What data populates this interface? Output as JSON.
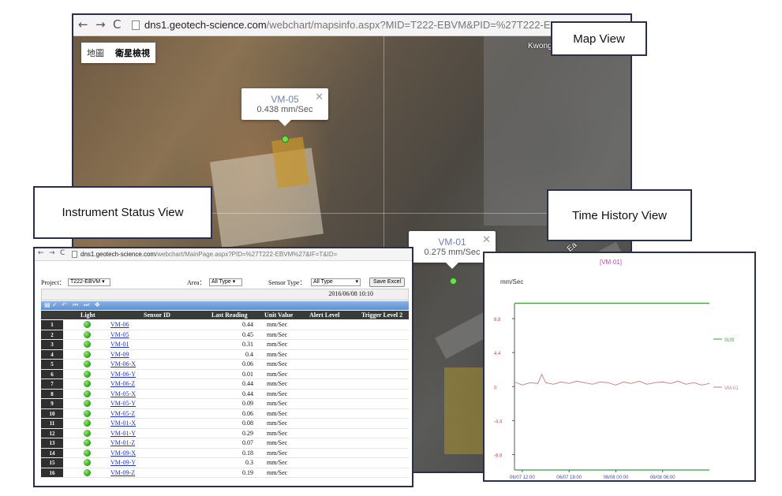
{
  "callouts": {
    "map": "Map View",
    "status": "Instrument Status View",
    "history": "Time History View"
  },
  "map_window": {
    "url_domain": "dns1.geotech-science.com",
    "url_path": "/webchart/mapsinfo.aspx?MID=T222-EBVM&PID=%27T222-EBVM%27",
    "map_type_tabs": [
      "地圖",
      "衛星檢視"
    ],
    "place_label": "Kwong",
    "road_label": "Ea",
    "popups": [
      {
        "name": "VM-05",
        "value": "0.438 mm/Sec"
      },
      {
        "name": "VM-01",
        "value": "0.275 mm/Sec"
      }
    ],
    "close_symbol": "✕"
  },
  "status_window": {
    "url_domain": "dns1.geotech-science.com",
    "url_path": "/webchart/MainPage.aspx?PID=%27T222-EBVM%27&IF=T&ID=",
    "project_label": "Project：",
    "project_value": "T222-EBVM",
    "area_label": "Area：",
    "area_value": "All Type",
    "sensor_type_label": "Sensor Type：",
    "sensor_type_value": "All Type",
    "save_button": "Save Excel",
    "timestamp": "2016/06/08 10:10",
    "columns": [
      "Light",
      "Sensor ID",
      "Last Reading",
      "Unit Value",
      "Alert Level",
      "Trigger Level 2"
    ],
    "rows": [
      {
        "n": "1",
        "id": "VM-06",
        "reading": "0.44",
        "unit": "mm/Sec"
      },
      {
        "n": "2",
        "id": "VM-05",
        "reading": "0.45",
        "unit": "mm/Sec"
      },
      {
        "n": "3",
        "id": "VM-01",
        "reading": "0.31",
        "unit": "mm/Sec"
      },
      {
        "n": "4",
        "id": "VM-09",
        "reading": "0.4",
        "unit": "mm/Sec"
      },
      {
        "n": "5",
        "id": "VM-06-X",
        "reading": "0.06",
        "unit": "mm/Sec"
      },
      {
        "n": "6",
        "id": "VM-06-Y",
        "reading": "0.01",
        "unit": "mm/Sec"
      },
      {
        "n": "7",
        "id": "VM-06-Z",
        "reading": "0.44",
        "unit": "mm/Sec"
      },
      {
        "n": "8",
        "id": "VM-05-X",
        "reading": "0.44",
        "unit": "mm/Sec"
      },
      {
        "n": "9",
        "id": "VM-05-Y",
        "reading": "0.09",
        "unit": "mm/Sec"
      },
      {
        "n": "10",
        "id": "VM-05-Z",
        "reading": "0.06",
        "unit": "mm/Sec"
      },
      {
        "n": "11",
        "id": "VM-01-X",
        "reading": "0.08",
        "unit": "mm/Sec"
      },
      {
        "n": "12",
        "id": "VM-01-Y",
        "reading": "0.29",
        "unit": "mm/Sec"
      },
      {
        "n": "13",
        "id": "VM-01-Z",
        "reading": "0.07",
        "unit": "mm/Sec"
      },
      {
        "n": "14",
        "id": "VM-09-X",
        "reading": "0.18",
        "unit": "mm/Sec"
      },
      {
        "n": "15",
        "id": "VM-09-Y",
        "reading": "0.3",
        "unit": "mm/Sec"
      },
      {
        "n": "16",
        "id": "VM-09-Z",
        "reading": "0.19",
        "unit": "mm/Sec"
      }
    ],
    "status_color": "#2c9b1a"
  },
  "chart_data": {
    "type": "line",
    "title": "[VM-01]",
    "ylabel": "mm/Sec",
    "xlabel": "",
    "ylim": [
      -10.8,
      13.2
    ],
    "yticks": [
      8.8,
      4.4,
      0,
      -4.4,
      -8.8
    ],
    "ytick_labels": [
      "8.8",
      "4.4",
      "0",
      "-4.4",
      "-8.8"
    ],
    "xticks": [
      "06/07 12:00",
      "06/07 18:00",
      "06/08 00:00",
      "06/08 06:00"
    ],
    "xlim_hours": [
      0,
      25
    ],
    "series": [
      {
        "name": "SUS",
        "color": "#3a9a3a",
        "x": [
          0,
          25
        ],
        "values": [
          10.8,
          10.8
        ]
      },
      {
        "name": "SUS",
        "color": "#3a9a3a",
        "x": [
          0,
          25
        ],
        "values": [
          -10.8,
          -10.8
        ]
      },
      {
        "name": "VM-01",
        "color": "#c77b7b",
        "x": [
          0,
          1,
          2,
          3,
          3.5,
          4,
          5,
          6,
          7,
          8,
          9,
          10,
          11,
          12,
          13,
          14,
          15,
          16,
          17,
          18,
          19,
          20,
          21,
          22,
          23,
          24,
          25
        ],
        "values": [
          0.6,
          0.2,
          0.5,
          0.4,
          1.6,
          0.5,
          0.3,
          0.6,
          0.4,
          0.7,
          0.5,
          0.3,
          0.6,
          0.5,
          0.2,
          0.6,
          0.4,
          0.7,
          0.3,
          0.5,
          0.6,
          0.4,
          0.7,
          0.3,
          0.5,
          0.2,
          0.4
        ]
      }
    ],
    "legend": [
      {
        "label": "SUS",
        "color": "#3a9a3a"
      },
      {
        "label": "VM-01",
        "color": "#c77b7b"
      }
    ],
    "legend_position": "right"
  }
}
